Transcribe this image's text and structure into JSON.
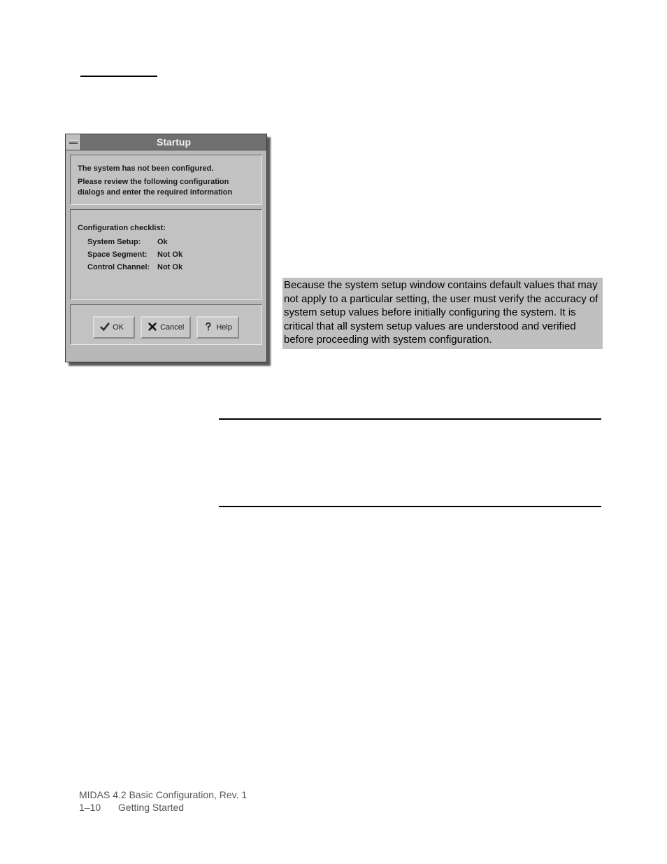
{
  "dialog": {
    "title": "Startup",
    "message_line1": "The system has not been configured.",
    "message_line2": "Please review the following configuration dialogs and enter the required information",
    "checklist_heading": "Configuration checklist:",
    "items": [
      {
        "label": "System Setup:",
        "value": "Ok"
      },
      {
        "label": "Space Segment:",
        "value": "Not Ok"
      },
      {
        "label": "Control Channel:",
        "value": "Not Ok"
      }
    ],
    "buttons": {
      "ok": "OK",
      "cancel": "Cancel",
      "help": "Help"
    }
  },
  "callout_text": "Because the system setup window contains default values that may not apply to a particular setting, the user must verify the accuracy of system setup values before initially configuring the system. It is critical that all system setup values are understood and verified before proceeding with system configuration.",
  "footer": {
    "line1": "MIDAS 4.2 Basic Configuration, Rev. 1",
    "page_number": "1–10",
    "section": "Getting Started"
  }
}
